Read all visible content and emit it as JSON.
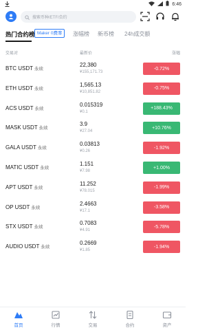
{
  "status": {
    "time": "6:46"
  },
  "search": {
    "placeholder": "搜索币种/ETF/合约"
  },
  "tabs": [
    {
      "label": "热门合约榜"
    },
    {
      "label": "涨幅榜"
    },
    {
      "label": "新币榜"
    },
    {
      "label": "24h成交额"
    }
  ],
  "maker_badge": "Maker 0费率",
  "columns": {
    "pair": "交易对",
    "price": "最新价",
    "change": "涨幅"
  },
  "rows": [
    {
      "base": "BTC USDT",
      "suffix": "永续",
      "price": "22,380",
      "fiat": "¥155,171.73",
      "change": "-0.72%",
      "dir": "down"
    },
    {
      "base": "ETH USDT",
      "suffix": "永续",
      "price": "1,565.13",
      "fiat": "¥10,851.82",
      "change": "-0.75%",
      "dir": "down"
    },
    {
      "base": "ACS USDT",
      "suffix": "永续",
      "price": "0.015319",
      "fiat": "¥0.1",
      "change": "+188.43%",
      "dir": "up"
    },
    {
      "base": "MASK USDT",
      "suffix": "永续",
      "price": "3.9",
      "fiat": "¥27.04",
      "change": "+10.76%",
      "dir": "up"
    },
    {
      "base": "GALA USDT",
      "suffix": "永续",
      "price": "0.03813",
      "fiat": "¥0.26",
      "change": "-1.92%",
      "dir": "down"
    },
    {
      "base": "MATIC USDT",
      "suffix": "永续",
      "price": "1.151",
      "fiat": "¥7.98",
      "change": "+1.00%",
      "dir": "up"
    },
    {
      "base": "APT USDT",
      "suffix": "永续",
      "price": "11.252",
      "fiat": "¥78.015",
      "change": "-1.99%",
      "dir": "down"
    },
    {
      "base": "OP USDT",
      "suffix": "永续",
      "price": "2.4663",
      "fiat": "¥17.1",
      "change": "-3.58%",
      "dir": "down"
    },
    {
      "base": "STX USDT",
      "suffix": "永续",
      "price": "0.7083",
      "fiat": "¥4.91",
      "change": "-5.78%",
      "dir": "down"
    },
    {
      "base": "AUDIO USDT",
      "suffix": "永续",
      "price": "0.2669",
      "fiat": "¥1.85",
      "change": "-1.94%",
      "dir": "down"
    }
  ],
  "nav": [
    {
      "label": "首页",
      "icon": "home-icon"
    },
    {
      "label": "行情",
      "icon": "market-icon"
    },
    {
      "label": "交易",
      "icon": "trade-icon"
    },
    {
      "label": "合约",
      "icon": "futures-icon"
    },
    {
      "label": "资产",
      "icon": "wallet-icon"
    }
  ],
  "colors": {
    "accent": "#2e7cf6",
    "up": "#39b874",
    "down": "#ef5663"
  }
}
